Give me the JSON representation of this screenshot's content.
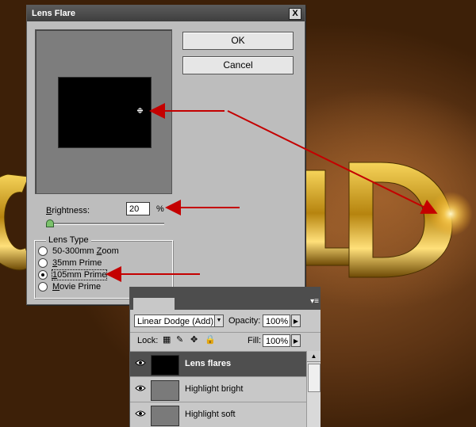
{
  "dialog": {
    "title": "Lens Flare",
    "close_label": "X",
    "ok_label": "OK",
    "cancel_label": "Cancel",
    "brightness_label": "rightness:",
    "brightness_label_mnemonic": "B",
    "brightness_value": "20",
    "brightness_unit": "%",
    "brightness_slider_fraction": 0.0,
    "lens_type_title": "Lens Type",
    "lens_types": [
      {
        "mnemonic_pre": "50-300mm ",
        "mnemonic": "Z",
        "label_post": "oom",
        "checked": false
      },
      {
        "mnemonic_pre": "",
        "mnemonic": "3",
        "label_post": "5mm Prime",
        "checked": false
      },
      {
        "mnemonic_pre": "",
        "mnemonic": "1",
        "label_post": "05mm Prime",
        "checked": true
      },
      {
        "mnemonic_pre": "",
        "mnemonic": "M",
        "label_post": "ovie Prime",
        "checked": false
      }
    ]
  },
  "layers": {
    "blend_mode": "Linear Dodge (Add)",
    "opacity_label": "Opacity:",
    "opacity_value": "100%",
    "lock_label": "Lock:",
    "fill_label": "Fill:",
    "fill_value": "100%",
    "items": [
      {
        "name": "Lens flares",
        "active": true
      },
      {
        "name": "Highlight bright",
        "active": false
      },
      {
        "name": "Highlight soft",
        "active": false
      }
    ]
  },
  "colors": {
    "arrow_red": "#c40000",
    "gold": "#e0b020",
    "dialog_bg": "#bdbdbd",
    "active_layer_bg": "#4f4f4f"
  }
}
